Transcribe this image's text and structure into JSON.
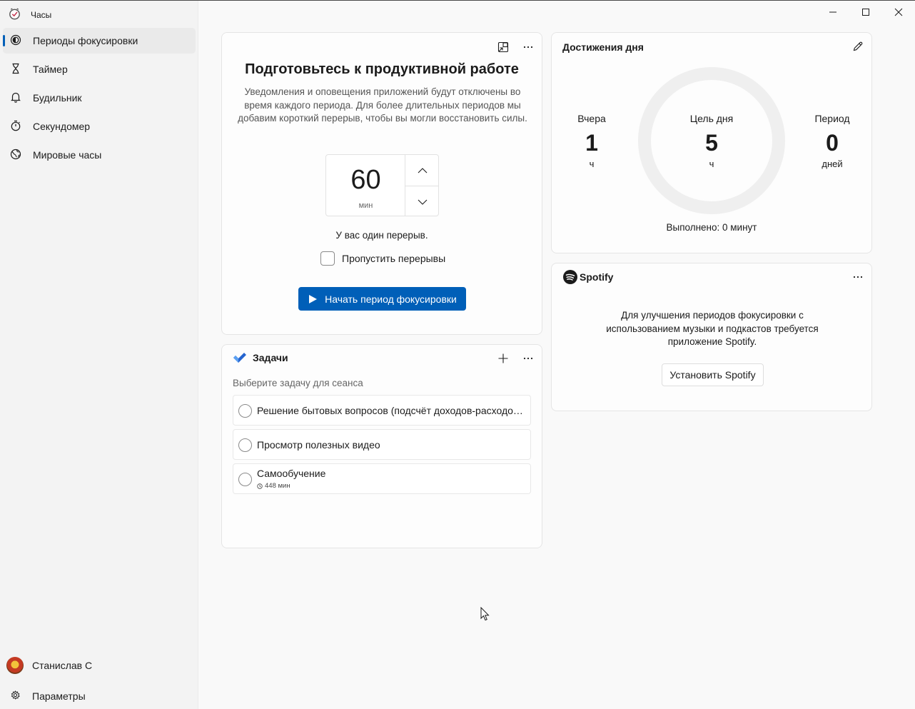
{
  "app": {
    "title": "Часы"
  },
  "sidebar": {
    "items": [
      {
        "label": "Периоды фокусировки",
        "icon": "focus-icon",
        "active": true
      },
      {
        "label": "Таймер",
        "icon": "hourglass-icon"
      },
      {
        "label": "Будильник",
        "icon": "bell-icon"
      },
      {
        "label": "Секундомер",
        "icon": "stopwatch-icon"
      },
      {
        "label": "Мировые часы",
        "icon": "globe-icon"
      }
    ],
    "user": {
      "name": "Станислав С"
    },
    "settings": {
      "label": "Параметры"
    }
  },
  "focus": {
    "title": "Подготовьтесь к продуктивной работе",
    "description": "Уведомления и оповещения приложений будут отключены во время каждого периода. Для более длительных периодов мы добавим короткий перерыв, чтобы вы могли восстановить силы.",
    "minutes": "60",
    "unit": "мин",
    "break_info": "У вас один перерыв.",
    "skip_label": "Пропустить перерывы",
    "start_label": "Начать период фокусировки"
  },
  "achievements": {
    "title": "Достижения дня",
    "yesterday": {
      "label": "Вчера",
      "value": "1",
      "unit": "ч"
    },
    "goal": {
      "label": "Цель дня",
      "value": "5",
      "unit": "ч"
    },
    "streak": {
      "label": "Период",
      "value": "0",
      "unit": "дней"
    },
    "done": "Выполнено: 0 минут"
  },
  "spotify": {
    "brand": "Spotify",
    "message": "Для улучшения периодов фокусировки с использованием музыки и подкастов требуется приложение Spotify.",
    "install_label": "Установить Spotify"
  },
  "tasks": {
    "title": "Задачи",
    "hint": "Выберите задачу для сеанса",
    "items": [
      {
        "text": "Решение бытовых вопросов (подсчёт доходов-расходов, покупка продуктов)"
      },
      {
        "text": "Просмотр полезных видео"
      },
      {
        "text": "Самообучение",
        "duration": "448 мин"
      }
    ]
  },
  "colors": {
    "accent": "#005fb8",
    "todo_blue": "#2564cf"
  }
}
